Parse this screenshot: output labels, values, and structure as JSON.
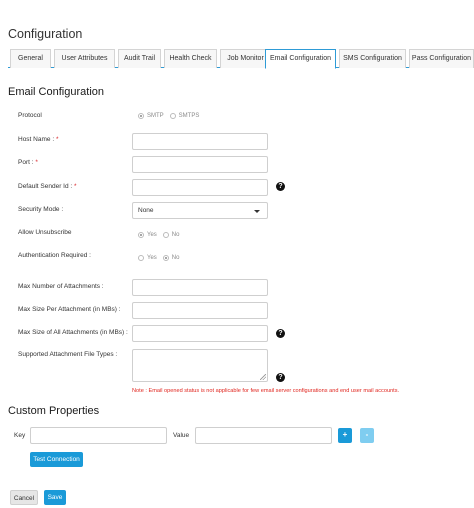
{
  "header": {
    "title": "Configuration"
  },
  "tabs": [
    {
      "label": "General",
      "active": false
    },
    {
      "label": "User Attributes",
      "active": false
    },
    {
      "label": "Audit Trail",
      "active": false
    },
    {
      "label": "Health Check",
      "active": false
    },
    {
      "label": "Job Monitor",
      "active": false
    },
    {
      "label": "Email Configuration",
      "active": true
    },
    {
      "label": "SMS Configuration",
      "active": false
    },
    {
      "label": "Pass Configuration",
      "active": false
    }
  ],
  "email": {
    "section_title": "Email Configuration",
    "protocol": {
      "label": "Protocol",
      "options": [
        "SMTP",
        "SMTPS"
      ],
      "selected": "SMTP"
    },
    "host_name": {
      "label": "Host Name :",
      "required_mark": "*",
      "value": ""
    },
    "port": {
      "label": "Port :",
      "required_mark": "*",
      "value": ""
    },
    "default_sender": {
      "label": "Default Sender Id :",
      "required_mark": "*",
      "value": ""
    },
    "security_mode": {
      "label": "Security Mode :",
      "value": "None"
    },
    "allow_unsubscribe": {
      "label": "Allow Unsubscribe",
      "options": [
        "Yes",
        "No"
      ],
      "selected": "Yes"
    },
    "auth_required": {
      "label": "Authentication Required :",
      "options": [
        "Yes",
        "No"
      ],
      "selected": "No"
    },
    "max_attachments": {
      "label": "Max Number of Attachments :",
      "value": ""
    },
    "max_size_per": {
      "label": "Max Size Per Attachment (in MBs) :",
      "value": ""
    },
    "max_size_all": {
      "label": "Max Size of All Attachments (in MBs) :",
      "value": ""
    },
    "file_types": {
      "label": "Supported Attachment File Types :",
      "value": ""
    },
    "help_glyph": "?",
    "note": "Note : Email opened status is not applicable for few email server configurations and end user mail accounts."
  },
  "custom": {
    "section_title": "Custom Properties",
    "key_label": "Key",
    "value_label": "Value",
    "add_glyph": "+",
    "remove_glyph": "-",
    "test_button": "Test Connection"
  },
  "footer": {
    "cancel_label": "Cancel",
    "save_label": "Save"
  },
  "colors": {
    "accent": "#1a9ad8",
    "accent_light": "#7fcdf0",
    "required": "#d9262b",
    "note": "#e0261f"
  },
  "icons": {
    "help": "help-circle-icon",
    "dropdown": "caret-down-icon"
  }
}
